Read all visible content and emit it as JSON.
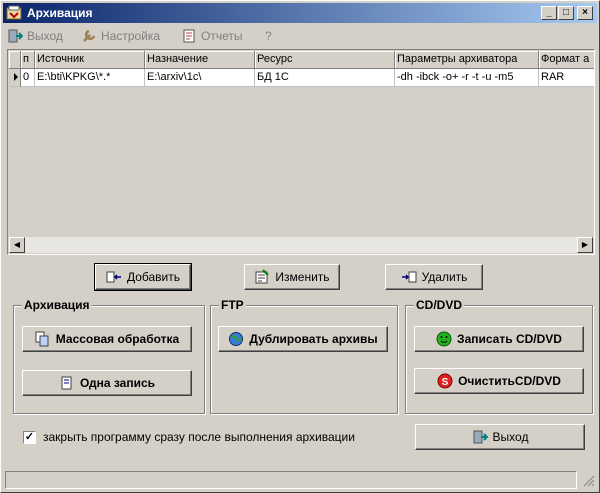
{
  "window": {
    "title": "Архивация"
  },
  "menu": [
    {
      "label": "Выход",
      "icon": "exit-icon"
    },
    {
      "label": "Настройка",
      "icon": "settings-icon"
    },
    {
      "label": "Отчеты",
      "icon": "reports-icon"
    },
    {
      "label": "?",
      "icon": ""
    }
  ],
  "grid": {
    "columns": [
      "п",
      "Источник",
      "Назначение",
      "Ресурс",
      "Параметры архиватора",
      "Формат а"
    ],
    "rows": [
      [
        "0",
        "E:\\bti\\KPKG\\*.*",
        "E:\\arxiv\\1c\\",
        "БД 1С",
        "-dh -ibck -o+ -r -t -u -m5",
        "RAR"
      ]
    ]
  },
  "toolbar": {
    "add": "Добавить",
    "edit": "Изменить",
    "delete": "Удалить"
  },
  "groups": {
    "archive": {
      "title": "Архивация",
      "bulk": "Массовая обработка",
      "single": "Одна запись"
    },
    "ftp": {
      "title": "FTP",
      "duplicate": "Дублировать архивы"
    },
    "cd": {
      "title": "CD/DVD",
      "write": "Записать CD/DVD",
      "clear": "ОчиститьCD/DVD"
    }
  },
  "options": {
    "close_after": "закрыть программу сразу после выполнения архивации",
    "close_after_checked": true
  },
  "footer": {
    "exit": "Выход"
  }
}
